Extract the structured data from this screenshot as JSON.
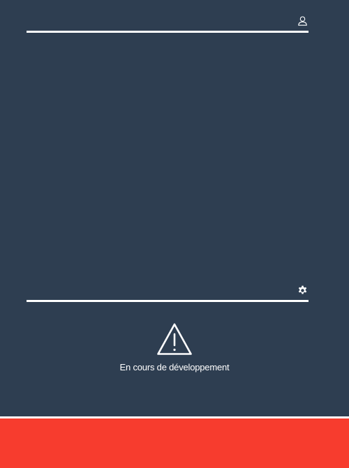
{
  "colors": {
    "background": "#2e3e51",
    "divider": "#ffffff",
    "footer": "#f73c2e"
  },
  "top_section": {
    "icon": "user-icon"
  },
  "bottom_section": {
    "icon": "gear-icon"
  },
  "notice": {
    "icon": "warning-icon",
    "text": "En cours de développement"
  }
}
